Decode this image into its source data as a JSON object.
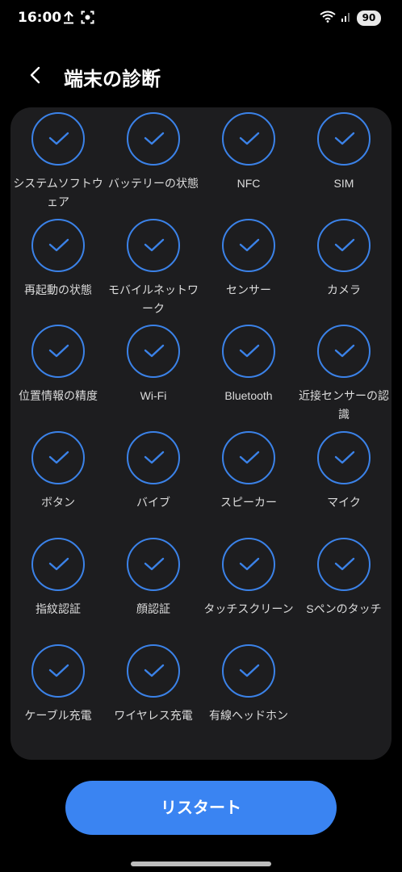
{
  "status_bar": {
    "time": "16:00",
    "battery": "90",
    "left_icons": [
      "upload-icon",
      "screenshot-icon"
    ],
    "right_icons": [
      "wifi-icon",
      "signal-icon"
    ]
  },
  "header": {
    "back_icon": "chevron-left-icon",
    "title": "端末の診断"
  },
  "diagnostics": {
    "items": [
      {
        "label": "システムソフトウェア",
        "status": "passed"
      },
      {
        "label": "バッテリーの状態",
        "status": "passed"
      },
      {
        "label": "NFC",
        "status": "passed"
      },
      {
        "label": "SIM",
        "status": "passed"
      },
      {
        "label": "再起動の状態",
        "status": "passed"
      },
      {
        "label": "モバイルネットワーク",
        "status": "passed"
      },
      {
        "label": "センサー",
        "status": "passed"
      },
      {
        "label": "カメラ",
        "status": "passed"
      },
      {
        "label": "位置情報の精度",
        "status": "passed"
      },
      {
        "label": "Wi-Fi",
        "status": "passed"
      },
      {
        "label": "Bluetooth",
        "status": "passed"
      },
      {
        "label": "近接センサーの認識",
        "status": "passed"
      },
      {
        "label": "ボタン",
        "status": "passed"
      },
      {
        "label": "バイブ",
        "status": "passed"
      },
      {
        "label": "スピーカー",
        "status": "passed"
      },
      {
        "label": "マイク",
        "status": "passed"
      },
      {
        "label": "指紋認証",
        "status": "passed"
      },
      {
        "label": "顔認証",
        "status": "passed"
      },
      {
        "label": "タッチスクリーン",
        "status": "passed"
      },
      {
        "label": "Sペンのタッチ",
        "status": "passed"
      },
      {
        "label": "ケーブル充電",
        "status": "passed"
      },
      {
        "label": "ワイヤレス充電",
        "status": "passed"
      },
      {
        "label": "有線ヘッドホン",
        "status": "passed"
      }
    ]
  },
  "restart_button": {
    "label": "リスタート"
  },
  "colors": {
    "accent": "#3a84f2",
    "check_ring": "#3b82e8",
    "card_bg": "#1d1d1f"
  }
}
